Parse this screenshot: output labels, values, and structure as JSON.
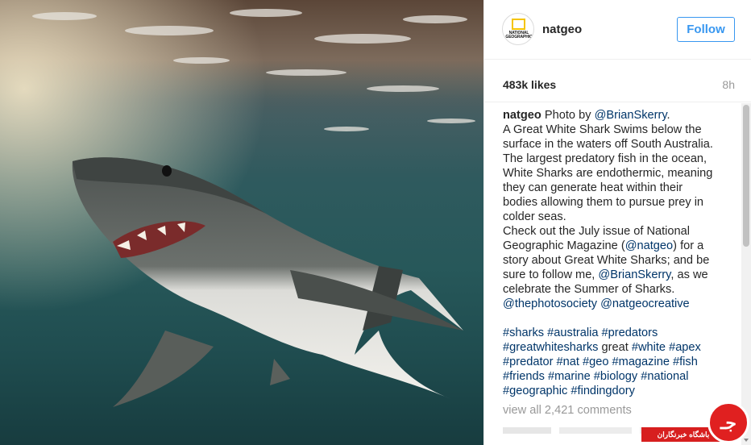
{
  "post": {
    "username": "natgeo",
    "avatar_text": "NATIONAL GEOGRAPHIC",
    "follow_label": "Follow",
    "likes": "483k likes",
    "time_ago": "8h",
    "caption_author": "natgeo",
    "caption_lines": [
      "Photo by ",
      "@BrianSkerry",
      ".",
      "A Great White Shark Swims below the surface in the waters off South Australia. The largest predatory fish in the ocean, White Sharks are endothermic, meaning they can generate heat within their bodies allowing them to pursue prey in colder seas.",
      "Check out the July issue of National Geographic Magazine (",
      "@natgeo",
      ") for a story about Great White Sharks; and be sure to follow me, ",
      "@BrianSkerry",
      ", as we celebrate the Summer of Sharks.",
      "@thephotosociety",
      "@natgeocreative"
    ],
    "hashtags": {
      "t1": "#sharks",
      "t2": "#australia",
      "t3": "#predators",
      "t4": "#greatwhitesharks",
      "w1": "great",
      "t5": "#white",
      "t6": "#apex",
      "t7": "#predator",
      "t8": "#nat",
      "t9": "#geo",
      "t10": "#magazine",
      "t11": "#fish",
      "t12": "#friends",
      "t13": "#marine",
      "t14": "#biology",
      "t15": "#national",
      "t16": "#geographic",
      "t17": "#findingdory"
    },
    "view_all_comments": "view all 2,421 comments"
  },
  "watermark": {
    "text": "باشگاه خبرنگاران",
    "logo_glyph": "جـ"
  },
  "colors": {
    "link": "#003569",
    "follow": "#3897f0",
    "muted": "#999999",
    "watermark_red": "#d71f1f"
  }
}
